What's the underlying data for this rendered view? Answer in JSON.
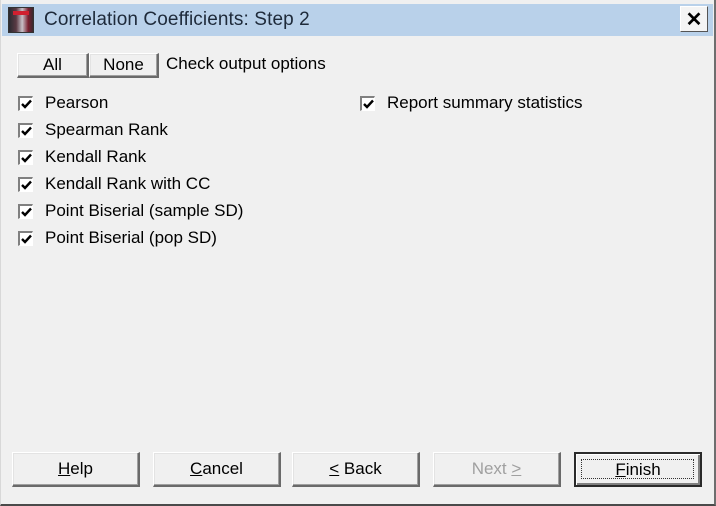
{
  "window": {
    "title": "Correlation Coefficients: Step 2",
    "close_label": "✕"
  },
  "toolbar": {
    "all_label": "All",
    "none_label": "None",
    "hint": "Check output options"
  },
  "options": [
    {
      "label": "Pearson",
      "checked": true
    },
    {
      "label": "Spearman Rank",
      "checked": true
    },
    {
      "label": "Kendall Rank",
      "checked": true
    },
    {
      "label": "Kendall Rank with CC",
      "checked": true
    },
    {
      "label": "Point Biserial (sample SD)",
      "checked": true
    },
    {
      "label": "Point Biserial (pop SD)",
      "checked": true
    }
  ],
  "summary_option": {
    "label": "Report summary statistics",
    "checked": true
  },
  "footer": {
    "help": {
      "mnemonic": "H",
      "rest": "elp"
    },
    "cancel": {
      "mnemonic": "C",
      "rest": "ancel"
    },
    "back": {
      "mnemonic": "<",
      "rest": " Back"
    },
    "next": {
      "text": "Next ",
      "mnemonic": ">",
      "disabled": true
    },
    "finish": {
      "mnemonic": "F",
      "rest": "inish",
      "default": true
    }
  }
}
